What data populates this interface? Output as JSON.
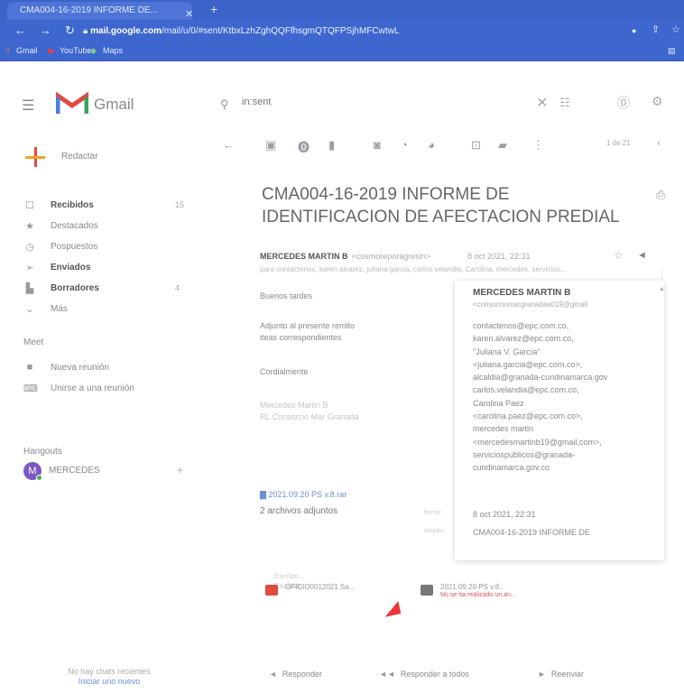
{
  "browser": {
    "tab_title": "CMA004-16-2019 INFORME DE...",
    "url_host": "mail.google.com",
    "url_path": "/mail/u/0/#sent/KtbxLzhZghQQFfhsgmQTQFPSjhMFCwtwL",
    "bookmarks": [
      "Gmail",
      "YouTube",
      "Maps"
    ]
  },
  "gmail": {
    "app_name": "Gmail",
    "search_value": "in:sent",
    "compose_label": "Redactar"
  },
  "sidebar": {
    "items": [
      {
        "label": "Recibidos",
        "count": "15",
        "icon": "inbox-icon",
        "bold": true
      },
      {
        "label": "Destacados",
        "count": "",
        "icon": "star-icon",
        "bold": false
      },
      {
        "label": "Pospuestos",
        "count": "",
        "icon": "clock-icon",
        "bold": false
      },
      {
        "label": "Enviados",
        "count": "",
        "icon": "send-icon",
        "bold": true
      },
      {
        "label": "Borradores",
        "count": "4",
        "icon": "draft-icon",
        "bold": true
      },
      {
        "label": "Más",
        "count": "",
        "icon": "chevron-down-icon",
        "bold": false
      }
    ],
    "meet_title": "Meet",
    "meet_items": [
      {
        "label": "Nueva reunión",
        "icon": "video-icon"
      },
      {
        "label": "Unirse a una reunión",
        "icon": "keyboard-icon"
      }
    ],
    "hangouts_title": "Hangouts",
    "hangouts_user": "MERCEDES",
    "avatar_letter": "M",
    "no_chats": "No hay chats recientes",
    "start_new": "Iniciar uno nuevo"
  },
  "toolbar": {
    "pager": "1 de 21"
  },
  "message": {
    "subject": "CMA004-16-2019 INFORME DE IDENTIFICACION DE AFECTACION PREDIAL",
    "sender_name": "MERCEDES MARTIN B",
    "sender_email": "<cosmoreporagresin>",
    "date": "8 oct 2021, 22:31",
    "to_line": "para contactenos, karen.alvarez, juliana.garcia, carlos.velandia, Carolina, mercedes, servicios...",
    "greeting": "Buenos tardes",
    "body_1": "Adjunto al presente remito",
    "body_2": "iteas correspondientes",
    "closing": "Cordialmente",
    "sig_1": "Mercedes Martin B",
    "sig_2": "RL Consorcio Mar Granada",
    "drive_link": "2021.09.20 PS v.8.rar",
    "attachments_title": "2 archivos adjuntos",
    "quote_1": "Escribe...",
    "quote_2": "Recibido...",
    "attachments": [
      {
        "name": "OFICIO0012021 Sa...",
        "sub": ""
      },
      {
        "name": "2021.09.20 PS v.8...",
        "sub": "No se ha realizado un an..."
      }
    ]
  },
  "details_popup": {
    "name": "MERCEDES MARTIN B",
    "email": "<consorciomargranadaa019@gmail",
    "recipients": [
      "contactenos@epc.com.co,",
      "karen.alvarez@epc.com.co,",
      "\"Juliana V. García\"",
      "<juliana.garcia@epc.com.co>,",
      "alcaldia@granada-cundinamarca.gov",
      "carlos.velandia@epc.com.co,",
      "Carolina Paez",
      "<carolina.paez@epc.com.co>,",
      "mercedes martin",
      "<mercedesmartinb19@gmail.com>,",
      "serviciospublicos@granada-",
      "cundinamarca.gov.co"
    ],
    "label_date": "fecha:",
    "label_subject": "asunto:",
    "date": "8 oct 2021, 22:31",
    "subject": "CMA004-16-2019 INFORME DE"
  },
  "footer": {
    "reply": "Responder",
    "reply_all": "Responder a todos",
    "forward": "Reenviar"
  },
  "colors": {
    "chrome_blue": "#3d66cf",
    "gmail_red": "#e04a3f",
    "link_blue": "#6b8fd6"
  }
}
